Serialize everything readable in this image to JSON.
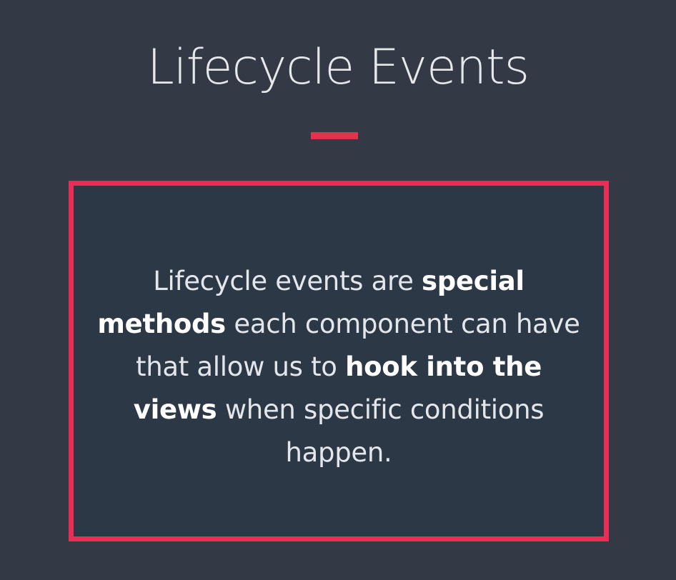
{
  "slide": {
    "title": "Lifecycle Events",
    "body": {
      "p1": "Lifecycle events are ",
      "b1": "special methods",
      "p2": " each component can have that allow us to ",
      "b2": "hook into the views",
      "p3": " when specific conditions happen."
    }
  },
  "colors": {
    "background": "#333a46",
    "panel": "#2d3847",
    "accent": "#ea2d55"
  }
}
